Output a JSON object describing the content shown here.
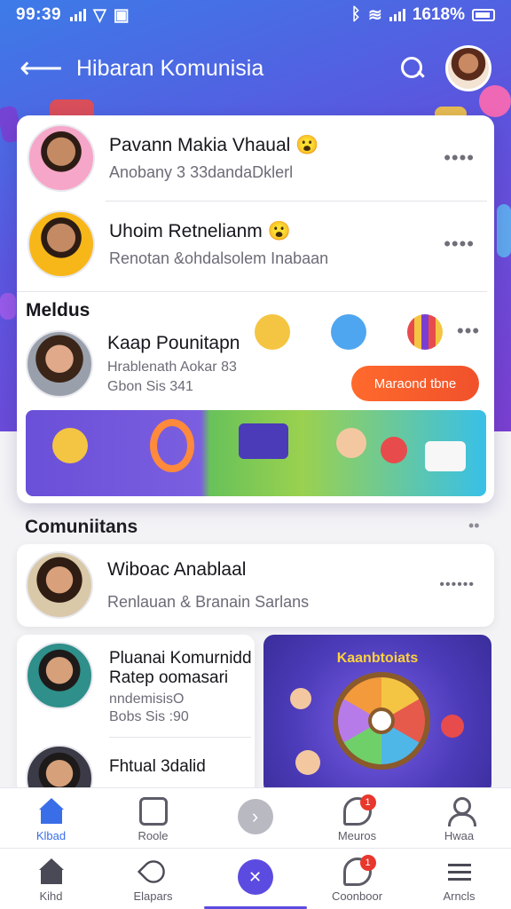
{
  "status": {
    "time": "99:39",
    "battery": "1618%"
  },
  "header": {
    "title": "Hibaran Komunisia",
    "back_glyph": "⟵"
  },
  "card": {
    "rows": [
      {
        "name": "Pavann Makia Vhaual",
        "emoji": "😮",
        "sub": "Anobany 3 33dandaDklerl",
        "more": "••••"
      },
      {
        "name": "Uhoim Retnelianm",
        "emoji": "😮",
        "sub": "Renotan &ohdalsolem Inabaan",
        "more": "••••"
      }
    ],
    "section_label": "Meldus",
    "featured": {
      "name": "Kaap Pounitapn",
      "sub1": "Hrablenath Aokar 83",
      "sub2": "Gbon Sis 341",
      "more": "•••",
      "button": "Maraond tbne"
    }
  },
  "communities": {
    "title": "Comuniitans",
    "more": "••",
    "item": {
      "name": "Wiboac Anablaal",
      "sub": "Renlauan & Branain Sarlans",
      "more": "••••••"
    },
    "card3": {
      "name1": "Pluanai Komurnidd",
      "name2": "Ratep oomasari",
      "sub1": "nndemisisO",
      "sub2": "Bobs Sis :90",
      "name3": "Fhtual 3dalid"
    },
    "promo_title": "Kaanbtoiats"
  },
  "nav_top": [
    {
      "label": "Klbad"
    },
    {
      "label": "Roole"
    },
    {
      "label": ""
    },
    {
      "label": "Meuros",
      "badge": "1"
    },
    {
      "label": "Hwaa"
    }
  ],
  "nav_bottom": [
    {
      "label": "Kihd"
    },
    {
      "label": "Elapars"
    },
    {
      "label": ""
    },
    {
      "label": "Coonboor",
      "badge": "1"
    },
    {
      "label": "Arncls"
    }
  ],
  "colors": {
    "accent": "#3a6ee8",
    "orange": "#f0512b",
    "purple": "#5b4be0"
  }
}
